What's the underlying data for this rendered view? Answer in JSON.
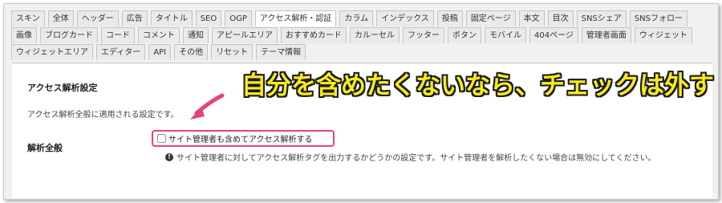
{
  "tabs": {
    "rows": [
      [
        "スキン",
        "全体",
        "ヘッダー",
        "広告",
        "タイトル",
        "SEO",
        "OGP",
        "アクセス解析・認証",
        "カラム",
        "インデックス",
        "投稿",
        "固定ページ",
        "本文",
        "目次",
        "SNSシェア",
        "SNSフォロー"
      ],
      [
        "画像",
        "ブログカード",
        "コード",
        "コメント",
        "通知",
        "アピールエリア",
        "おすすめカード",
        "カルーセル",
        "フッター",
        "ボタン",
        "モバイル",
        "404ページ",
        "管理者画面",
        "ウィジェット"
      ],
      [
        "ウィジェットエリア",
        "エディター",
        "API",
        "その他",
        "リセット",
        "テーマ情報"
      ]
    ],
    "active": "アクセス解析・認証"
  },
  "section": {
    "title": "アクセス解析設定",
    "description": "アクセス解析全般に適用される設定です。"
  },
  "field": {
    "label": "解析全般",
    "checkbox_label": "サイト管理者も含めてアクセス解析する",
    "checkbox_checked": false,
    "help_text": "サイト管理者に対してアクセス解析タグを出力するかどうかの設定です。サイト管理者を解析したくない場合は無効にしてください。",
    "help_icon": "info-icon"
  },
  "annotation": {
    "callout": "自分を含めたくないなら、チェックは外す",
    "callout_color": "#f6ea1e",
    "highlight_color": "#e8427a",
    "arrow_icon": "arrow-icon"
  }
}
